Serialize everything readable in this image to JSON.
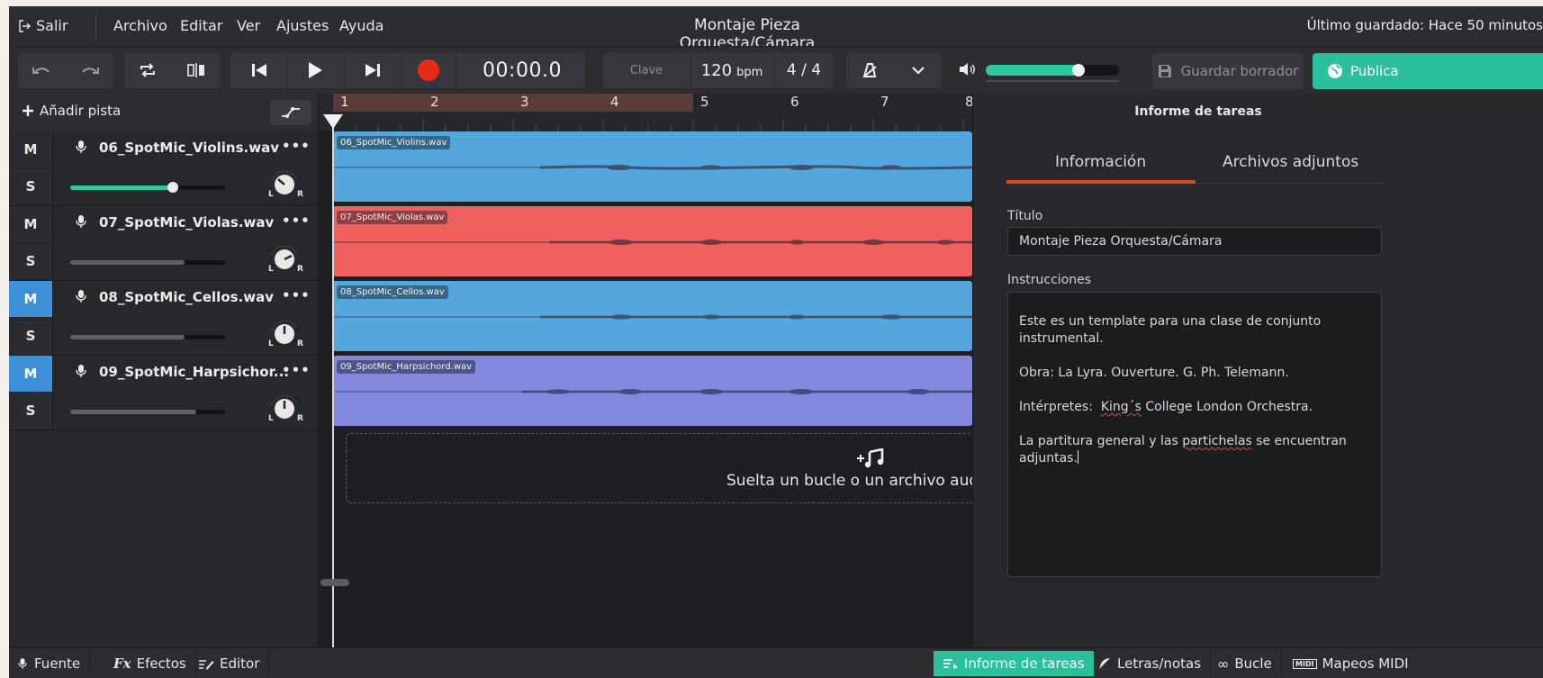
{
  "menu": {
    "exit_label": "Salir",
    "items": [
      "Archivo",
      "Editar",
      "Ver",
      "Ajustes",
      "Ayuda"
    ],
    "project_title": "Montaje Pieza Orquesta/Cámara",
    "last_saved": "Último guardado: Hace 50 minutos"
  },
  "toolbar": {
    "time": "00:00.0",
    "key_label": "Clave",
    "tempo_value": "120",
    "tempo_unit": "bpm",
    "time_signature": "4 / 4",
    "volume_level": 0.7,
    "save_draft_label": "Guardar borrador",
    "publish_label": "Publica",
    "accent_color": "#2cbf9b",
    "record_color": "#e52b13"
  },
  "tracks_panel": {
    "add_track_label": "Añadir pista",
    "tracks": [
      {
        "name": "06_SpotMic_Violins.wav",
        "mute": "M",
        "solo": "S",
        "mute_active": false,
        "volume": 0.67,
        "volume_color": "#2ec7a2",
        "pan": "L"
      },
      {
        "name": "07_SpotMic_Violas.wav",
        "mute": "M",
        "solo": "S",
        "mute_active": false,
        "volume": 0.74,
        "volume_color": "#5e6065",
        "pan": "R"
      },
      {
        "name": "08_SpotMic_Cellos.wav",
        "mute": "M",
        "solo": "S",
        "mute_active": true,
        "volume": 0.74,
        "volume_color": "#5e6065",
        "pan": "C"
      },
      {
        "name": "09_SpotMic_Harpsichor...",
        "mute": "M",
        "solo": "S",
        "mute_active": true,
        "volume": 0.81,
        "volume_color": "#5e6065",
        "pan": "C"
      }
    ],
    "pan_left": "L",
    "pan_right": "R"
  },
  "timeline": {
    "bars": [
      "1",
      "2",
      "3",
      "4",
      "5",
      "6",
      "7",
      "8"
    ],
    "clips": [
      {
        "label": "06_SpotMic_Violins.wav",
        "color": "#55a6dd"
      },
      {
        "label": "07_SpotMic_Violas.wav",
        "color": "#f0605f"
      },
      {
        "label": "08_SpotMic_Cellos.wav",
        "color": "#55a6dd"
      },
      {
        "label": "09_SpotMic_Harpsichord.wav",
        "color": "#8188de"
      }
    ],
    "drop_text": "Suelta un bucle o un archivo audi"
  },
  "task_report": {
    "header": "Informe de tareas",
    "tabs": [
      "Información",
      "Archivos adjuntos"
    ],
    "title_label": "Título",
    "title_value": "Montaje Pieza Orquesta/Cámara",
    "instructions_label": "Instrucciones",
    "instructions": {
      "line1": "Este es un template para una clase de conjunto instrumental.",
      "line2": "Obra: La Lyra. Ouverture. G. Ph. Telemann.",
      "line3_pre": "Intérpretes:  ",
      "line3_err": "King´s",
      "line3_post": " College London Orchestra.",
      "line4_pre": "La partitura general y las ",
      "line4_err": "partichelas",
      "line4_post": " se encuentran adjuntas."
    }
  },
  "bottom_bar": {
    "left": [
      "Fuente",
      "Efectos",
      "Editor"
    ],
    "right": [
      "Informe de tareas",
      "Letras/notas",
      "Bucle",
      "Mapeos MIDI"
    ]
  }
}
